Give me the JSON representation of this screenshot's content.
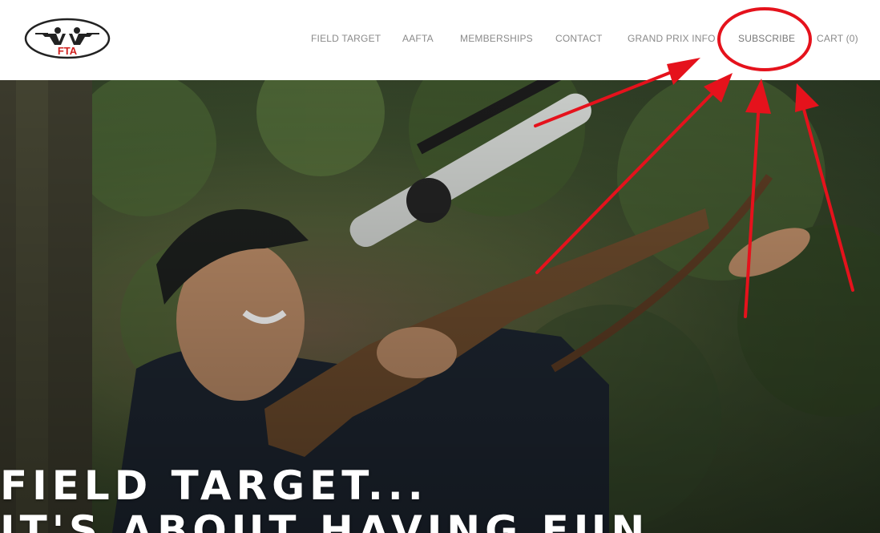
{
  "brand": {
    "logo_text": "FTA"
  },
  "nav": {
    "items": [
      {
        "label": "FIELD TARGET"
      },
      {
        "label": "AAFTA"
      },
      {
        "label": "MEMBERSHIPS"
      },
      {
        "label": "CONTACT"
      },
      {
        "label": "GRAND PRIX INFO"
      },
      {
        "label": "SUBSCRIBE"
      },
      {
        "label": "CART (0)"
      }
    ]
  },
  "hero": {
    "line1": "FIELD TARGET...",
    "line2": "IT'S ABOUT HAVING FUN"
  },
  "colors": {
    "annotation": "#e5121c",
    "logo_red": "#d0201e",
    "nav_text": "#8a8a8a"
  }
}
